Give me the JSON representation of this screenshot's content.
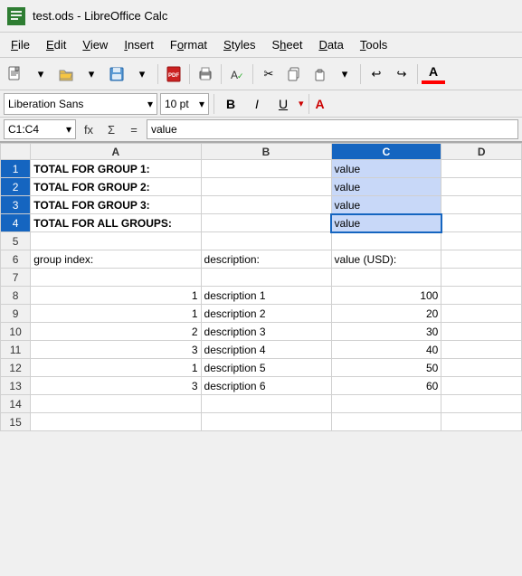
{
  "titleBar": {
    "appIcon": "✓",
    "title": "test.ods - LibreOffice Calc"
  },
  "menuBar": {
    "items": [
      {
        "label": "File",
        "underline": "F"
      },
      {
        "label": "Edit",
        "underline": "E"
      },
      {
        "label": "View",
        "underline": "V"
      },
      {
        "label": "Insert",
        "underline": "I"
      },
      {
        "label": "Format",
        "underline": "o"
      },
      {
        "label": "Styles",
        "underline": "S"
      },
      {
        "label": "Sheet",
        "underline": "h"
      },
      {
        "label": "Data",
        "underline": "D"
      },
      {
        "label": "Tools",
        "underline": "T"
      }
    ]
  },
  "formatBar": {
    "fontName": "Liberation Sans",
    "fontSize": "10 pt"
  },
  "formulaBar": {
    "cellRef": "C1:C4",
    "functionLabel": "fx",
    "sumLabel": "Σ",
    "equalsLabel": "=",
    "formula": "value"
  },
  "sheet": {
    "columnHeaders": [
      "",
      "A",
      "B",
      "C",
      "D"
    ],
    "rows": [
      {
        "row": 1,
        "a": "TOTAL FOR GROUP 1:",
        "b": "",
        "c": "value",
        "d": ""
      },
      {
        "row": 2,
        "a": "TOTAL FOR GROUP 2:",
        "b": "",
        "c": "value",
        "d": ""
      },
      {
        "row": 3,
        "a": "TOTAL FOR GROUP 3:",
        "b": "",
        "c": "value",
        "d": ""
      },
      {
        "row": 4,
        "a": "TOTAL FOR ALL GROUPS:",
        "b": "",
        "c": "value",
        "d": ""
      },
      {
        "row": 5,
        "a": "",
        "b": "",
        "c": "",
        "d": ""
      },
      {
        "row": 6,
        "a": "group index:",
        "b": "description:",
        "c": "value (USD):",
        "d": ""
      },
      {
        "row": 7,
        "a": "",
        "b": "",
        "c": "",
        "d": ""
      },
      {
        "row": 8,
        "a": "1",
        "b": "description 1",
        "c": "100",
        "d": ""
      },
      {
        "row": 9,
        "a": "1",
        "b": "description 2",
        "c": "20",
        "d": ""
      },
      {
        "row": 10,
        "a": "2",
        "b": "description 3",
        "c": "30",
        "d": ""
      },
      {
        "row": 11,
        "a": "3",
        "b": "description 4",
        "c": "40",
        "d": ""
      },
      {
        "row": 12,
        "a": "1",
        "b": "description 5",
        "c": "50",
        "d": ""
      },
      {
        "row": 13,
        "a": "3",
        "b": "description 6",
        "c": "60",
        "d": ""
      },
      {
        "row": 14,
        "a": "",
        "b": "",
        "c": "",
        "d": ""
      },
      {
        "row": 15,
        "a": "",
        "b": "",
        "c": "",
        "d": ""
      }
    ]
  }
}
